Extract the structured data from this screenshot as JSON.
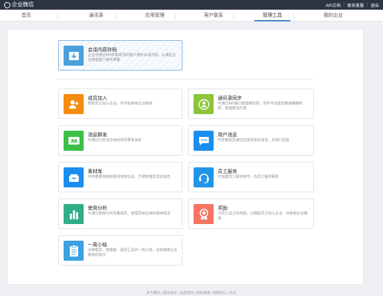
{
  "topbar": {
    "logo_text": "企业微信",
    "links": [
      "API文档",
      "联系客服",
      "退出"
    ]
  },
  "nav": {
    "items": [
      {
        "label": "首页",
        "active": false
      },
      {
        "label": "通讯录",
        "active": false
      },
      {
        "label": "应用管理",
        "active": false
      },
      {
        "label": "客户联系",
        "active": false
      },
      {
        "label": "管理工具",
        "active": true
      },
      {
        "label": "我的企业",
        "active": false
      }
    ]
  },
  "featured": {
    "title": "会话内容存档",
    "desc": "企业可通过API获取成员的客户服务会话内容，以满足企业管理客户服务质量",
    "color": "#4ba0dc",
    "icon": "archive-icon"
  },
  "tools": [
    {
      "title": "成员加入",
      "desc": "帮助员工加入企业，并开始使用企业微信",
      "color": "#f58b10",
      "icon": "member-join-icon"
    },
    {
      "title": "通讯录同步",
      "desc": "可通过API接口管理通讯录，同时可设置查看或编辑权限，管理更加方便",
      "color": "#8cc43a",
      "icon": "contact-sync-icon"
    },
    {
      "title": "消息群发",
      "desc": "可通过公告及应用给成员群发消息",
      "color": "#3cbf48",
      "icon": "mass-message-icon"
    },
    {
      "title": "用户消息",
      "desc": "可查看成员通过应用发送的消息，并进行回复",
      "color": "#1a8ef0",
      "icon": "user-message-icon"
    },
    {
      "title": "素材库",
      "desc": "可将重要常用的素材存放在此，方便管理员发送消息",
      "color": "#1a8ef0",
      "icon": "material-library-icon"
    },
    {
      "title": "员工服务",
      "desc": "可创建员工服务帐号，向员工提供服务",
      "color": "#2196e8",
      "icon": "employee-service-icon"
    },
    {
      "title": "使用分析",
      "desc": "可通过使用分析查看成员、管理员和应用的使用情况",
      "color": "#2fae88",
      "icon": "usage-analysis-icon"
    },
    {
      "title": "奖励",
      "desc": "为员工设立的奖励，以鼓励员工加入企业、并使用企业微信",
      "color": "#f57462",
      "icon": "reward-icon"
    },
    {
      "title": "一周小结",
      "desc": "为管理员、管理者、成员汇总的一周小结，总结使用企业微信的情况",
      "color": "#3ba1e0",
      "icon": "weekly-summary-icon"
    }
  ],
  "footer": {
    "text": "关于腾讯 | 服务协议 | 运营规范 | 隐私政策 | 帮助中心 | 中文"
  }
}
